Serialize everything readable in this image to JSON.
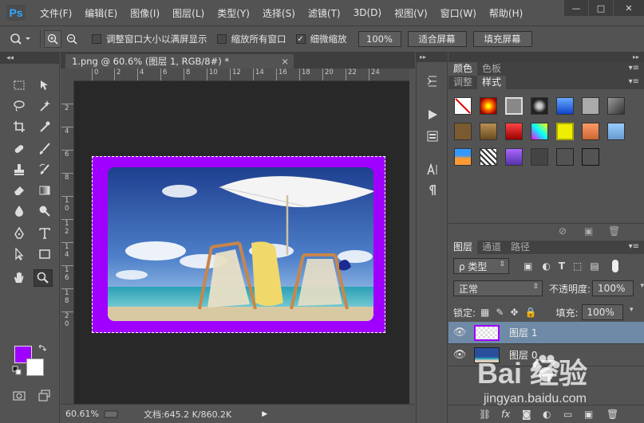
{
  "app": {
    "logo": "Ps"
  },
  "menu": [
    "文件(F)",
    "编辑(E)",
    "图像(I)",
    "图层(L)",
    "类型(Y)",
    "选择(S)",
    "滤镜(T)",
    "3D(D)",
    "视图(V)",
    "窗口(W)",
    "帮助(H)"
  ],
  "window_controls": {
    "minimize": "—",
    "maximize": "□",
    "close": "✕"
  },
  "options": {
    "resize_windows_label": "调整窗口大小以满屏显示",
    "resize_windows_checked": false,
    "zoom_all_label": "缩放所有窗口",
    "zoom_all_checked": false,
    "scrubby_zoom_label": "细微缩放",
    "scrubby_zoom_checked": true,
    "btn_100": "100%",
    "btn_fit": "适合屏幕",
    "btn_fill": "填充屏幕"
  },
  "document": {
    "tab_title": "1.png @ 60.6% (图层 1, RGB/8#) *",
    "close_glyph": "×"
  },
  "ruler": {
    "h_ticks": [
      "0",
      "2",
      "4",
      "6",
      "8",
      "10",
      "12",
      "14",
      "16",
      "18",
      "20",
      "22",
      "24"
    ],
    "v_ticks": [
      "2",
      "4",
      "6",
      "8",
      "1\n0",
      "1\n2",
      "1\n4",
      "1\n6",
      "1\n8",
      "2\n0"
    ]
  },
  "status": {
    "zoom": "60.61%",
    "docsize": "文档:645.2 K/860.2K"
  },
  "colors": {
    "foreground": "#a000ff",
    "background": "#ffffff",
    "selected_layer": "#6f8aa6"
  },
  "panels": {
    "top_tabs": [
      "颜色",
      "色板"
    ],
    "mid_tabs": [
      "调整",
      "样式"
    ],
    "layers_tabs": [
      "图层",
      "通道",
      "路径"
    ]
  },
  "layers": {
    "filter_kind": "ρ 类型",
    "blend_mode": "正常",
    "opacity_label": "不透明度:",
    "opacity_value": "100%",
    "lock_label": "锁定:",
    "fill_label": "填充:",
    "fill_value": "100%",
    "items": [
      {
        "name": "图层 1",
        "selected": true
      },
      {
        "name": "图层 0",
        "selected": false
      }
    ]
  },
  "watermark": {
    "logo": "Bai  经验",
    "url": "jingyan.baidu.com"
  }
}
